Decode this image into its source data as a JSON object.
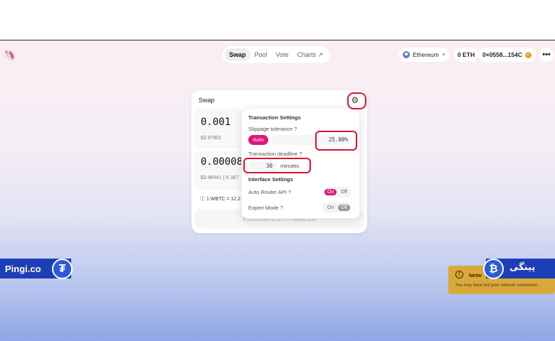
{
  "header": {
    "nav": [
      {
        "label": "Swap"
      },
      {
        "label": "Pool"
      },
      {
        "label": "Vote"
      },
      {
        "label": "Charts ↗"
      }
    ],
    "network": "Ethereum",
    "balance": "0 ETH",
    "address": "0×0558...154C",
    "more": "•••"
  },
  "swap": {
    "title": "Swap",
    "input_amount": "0.001",
    "input_usd": "$3.97901",
    "output_amount": "0.00008",
    "output_usd": "$3.96441 (-0.367",
    "rate": "1 WBTC = 12.2",
    "action": "Insufficient ETH balance"
  },
  "settings": {
    "title": "Transaction Settings",
    "slippage_label": "Slippage tolerance  ?",
    "auto_label": "Auto",
    "slippage_value": "25.00%",
    "deadline_label": "Transaction deadline  ?",
    "deadline_value": "30",
    "deadline_unit": "minutes",
    "interface_title": "Interface Settings",
    "auto_router_label": "Auto Router API  ?",
    "auto_router_on": "On",
    "auto_router_off": "Off",
    "auto_router_state": "On",
    "expert_label": "Expert Mode  ?",
    "expert_on": "On",
    "expert_off": "Off",
    "expert_state": "Off"
  },
  "toast": {
    "title": "Netw",
    "body": "You may have lost your network connection."
  },
  "watermark": {
    "left_text": "Pingi.co",
    "right_text": "پینگی"
  },
  "colors": {
    "accent_pink": "#e0177a",
    "highlight_red": "#e01030",
    "watermark_blue": "#1c3fb7",
    "toast_gold": "#d9a93b"
  }
}
